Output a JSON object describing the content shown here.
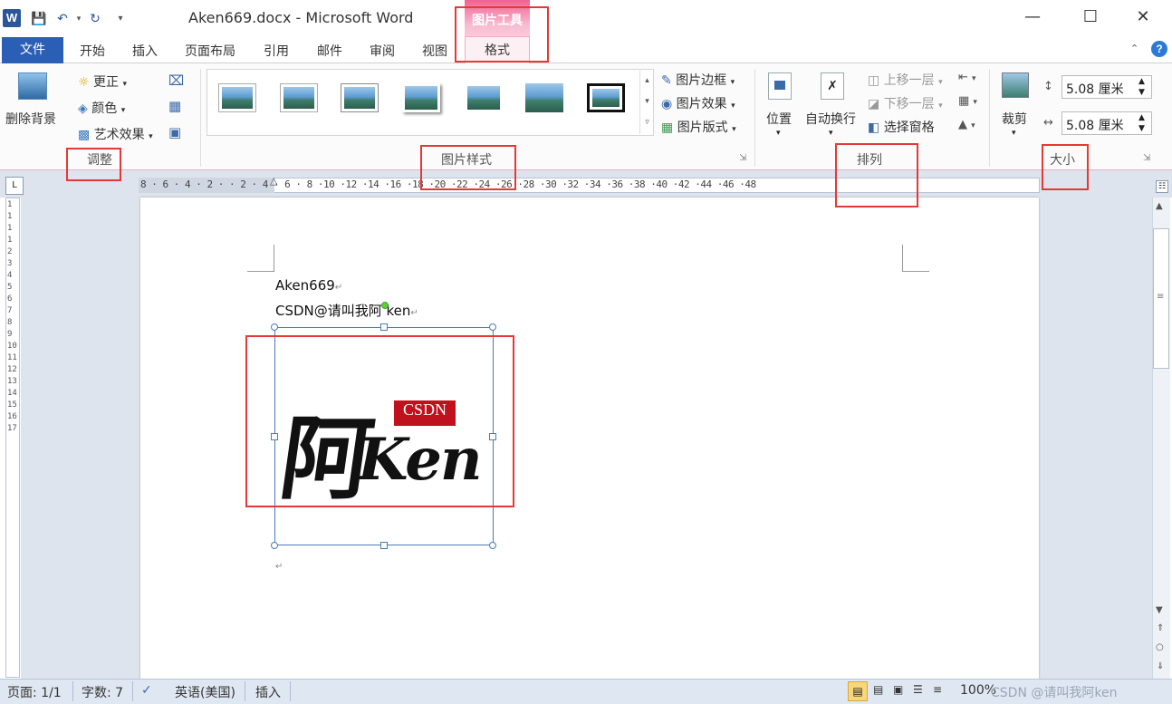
{
  "app": {
    "icon_letter": "W",
    "title": "Aken669.docx - Microsoft Word",
    "contextual_tab_group": "图片工具",
    "window_controls": [
      "minimize-icon",
      "maximize-icon",
      "close-icon"
    ]
  },
  "tabs": {
    "file": "文件",
    "items": [
      "开始",
      "插入",
      "页面布局",
      "引用",
      "邮件",
      "审阅",
      "视图"
    ],
    "active_contextual": "格式"
  },
  "ribbon": {
    "adjust": {
      "remove_bg": "删除背景",
      "corrections": "更正",
      "color": "颜色",
      "artistic": "艺术效果",
      "label": "调整"
    },
    "picture_styles": {
      "border": "图片边框",
      "effects": "图片效果",
      "layout": "图片版式",
      "label": "图片样式"
    },
    "arrange": {
      "position": "位置",
      "wrap": "自动换行",
      "bring_forward": "上移一层",
      "send_backward": "下移一层",
      "selection_pane": "选择窗格",
      "label": "排列"
    },
    "size": {
      "crop": "裁剪",
      "height": "5.08 厘米",
      "width": "5.08 厘米",
      "label": "大小"
    }
  },
  "ruler": {
    "horizontal": "8 · 6 · 4 · 2 ·  · 2 · 4 · 6 · 8 ·10 ·12 ·14 ·16 ·18 ·20 ·22 ·24 ·26 ·28 ·30 ·32 ·34 ·36 ·38 ·40 ·42 ·44 ·46 ·48",
    "vertical": "1 1 1 1 2 3 4 5 6 7 8 9 10 11 12 13 14 15 16 17",
    "corner": "L"
  },
  "document": {
    "line1": "Aken669",
    "line2": "CSDN@请叫我阿 ken",
    "logo_char": "阿",
    "logo_ken": "Ken",
    "logo_badge": "CSDN",
    "paragraph_mark": "↵"
  },
  "statusbar": {
    "page": "页面: 1/1",
    "words": "字数: 7",
    "language": "英语(美国)",
    "mode": "插入",
    "zoom": "100%",
    "watermark": "CSDN @请叫我阿ken"
  },
  "colors": {
    "accent": "#2b5fb5",
    "contextual": "#f06292",
    "annotation": "#e53935"
  }
}
